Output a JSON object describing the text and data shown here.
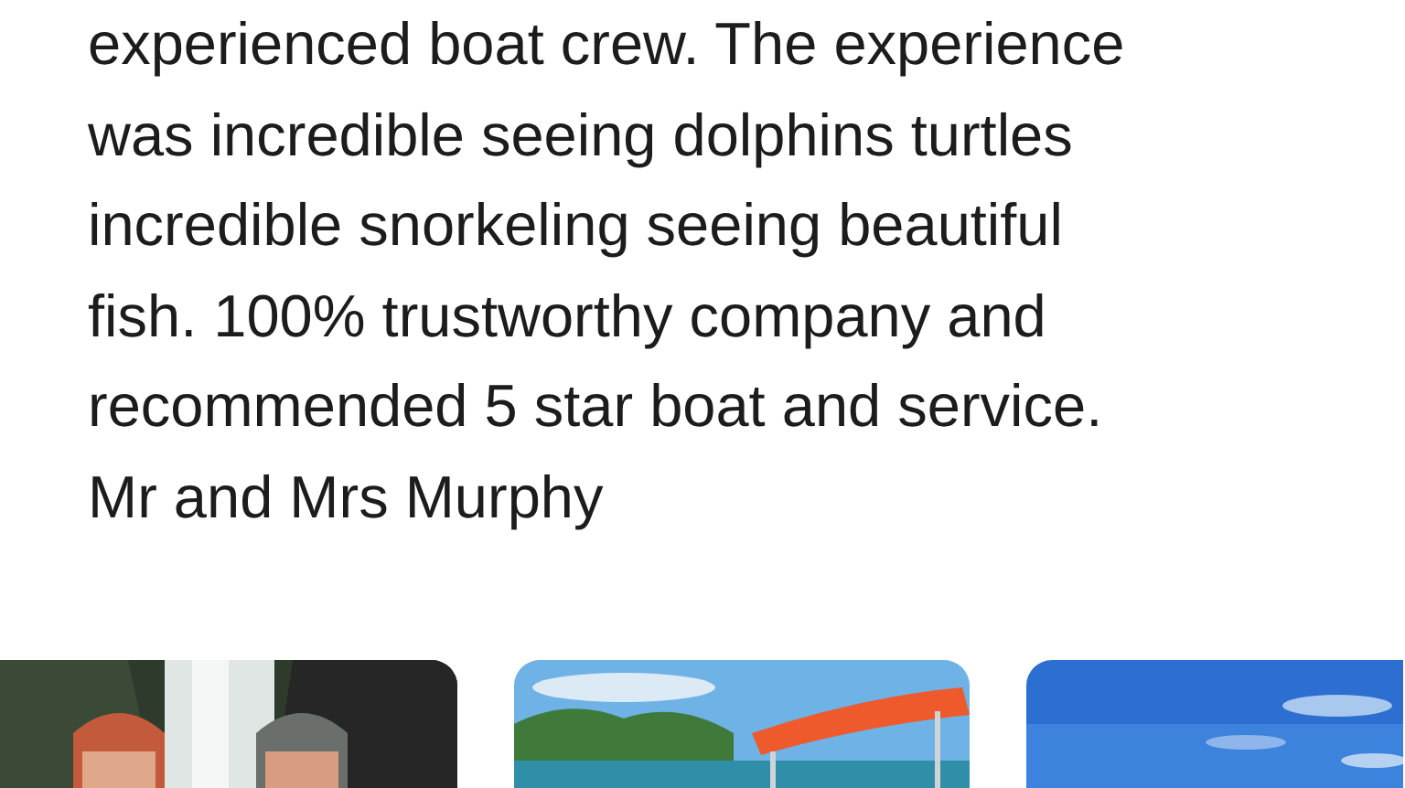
{
  "review": {
    "lines": [
      "experienced boat crew. The experience",
      "was incredible seeing dolphins turtles",
      "incredible snorkeling seeing beautiful",
      "fish. 100% trustworthy company and",
      "recommended 5 star boat and service.",
      "Mr and Mrs Murphy"
    ]
  }
}
